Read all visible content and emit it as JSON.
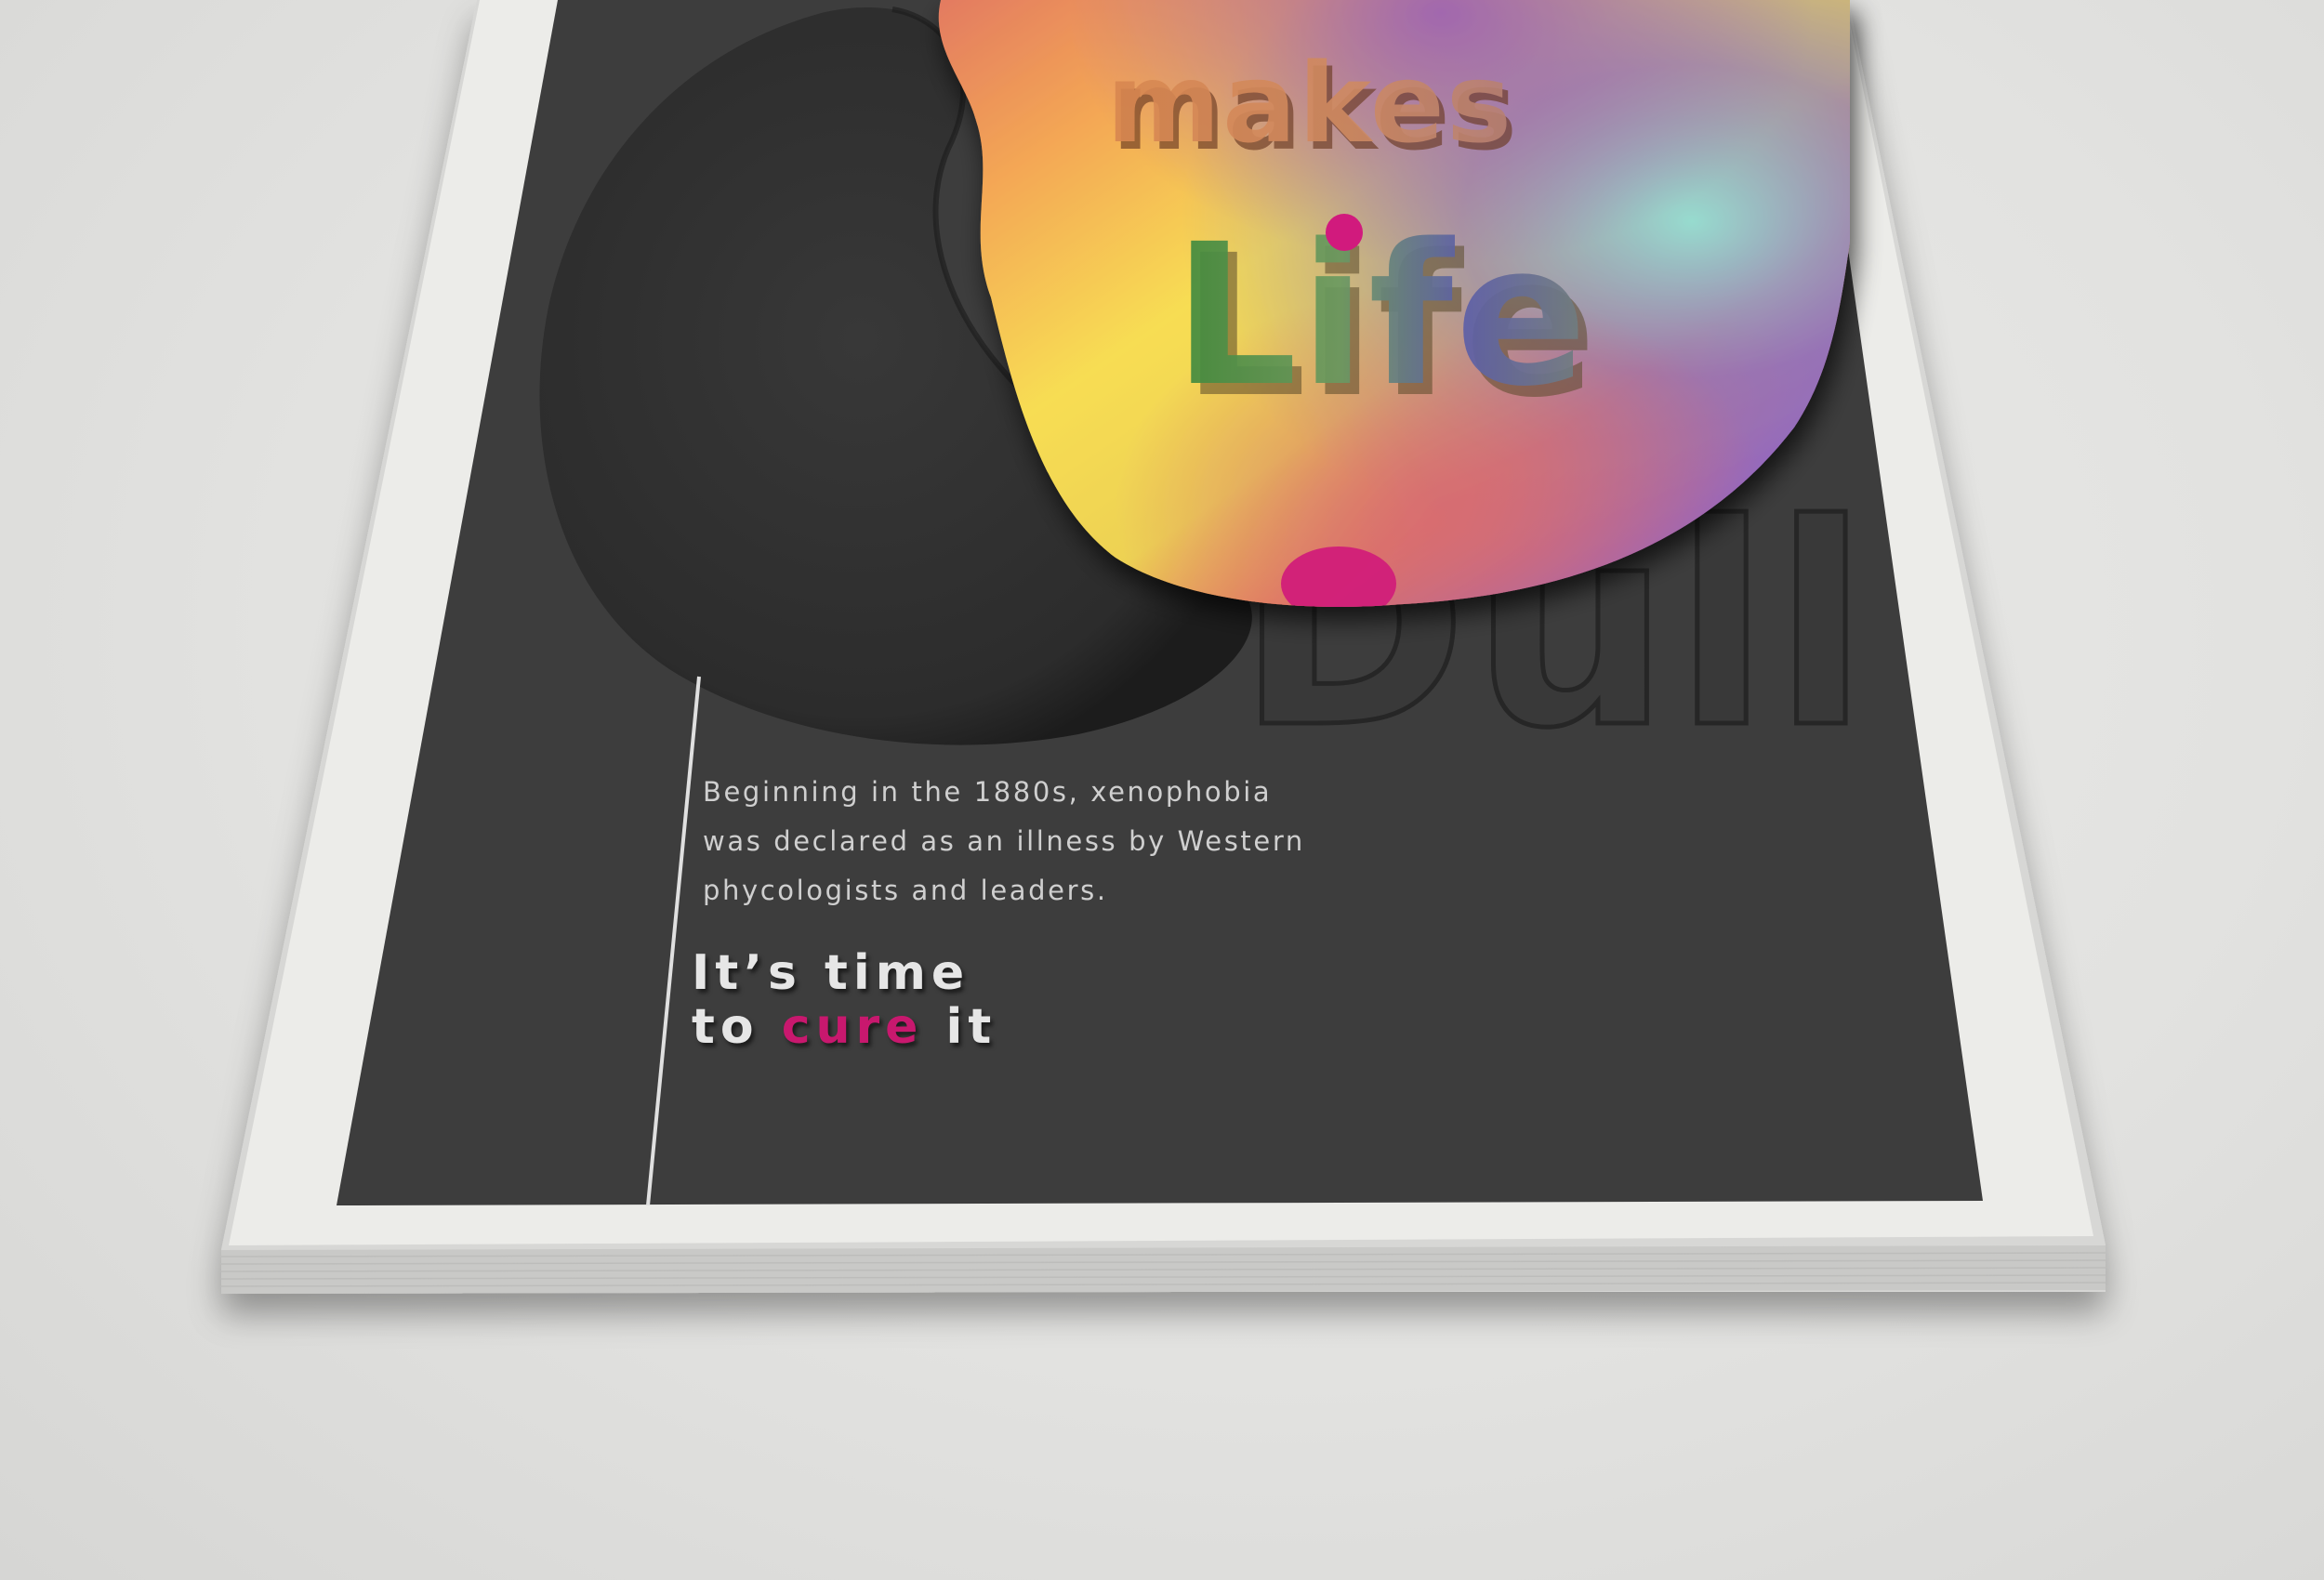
{
  "poster": {
    "headline": {
      "word_makes": "makes",
      "word_life": "Life",
      "word_dull": "Dull"
    },
    "body_lines": [
      "Beginning in the 1880s, xenophobia",
      "was declared as an illness by Western",
      "phycologists and leaders."
    ],
    "tagline": {
      "line1": "It’s time",
      "line2_before": "to ",
      "line2_accent": "cure",
      "line2_after": " it"
    }
  },
  "colors": {
    "background": "#e3e3e1",
    "paper": "#ececea",
    "poster_panel": "#3d3d3d",
    "accent_magenta": "#c8186e",
    "body_text": "#cfcfcf"
  }
}
